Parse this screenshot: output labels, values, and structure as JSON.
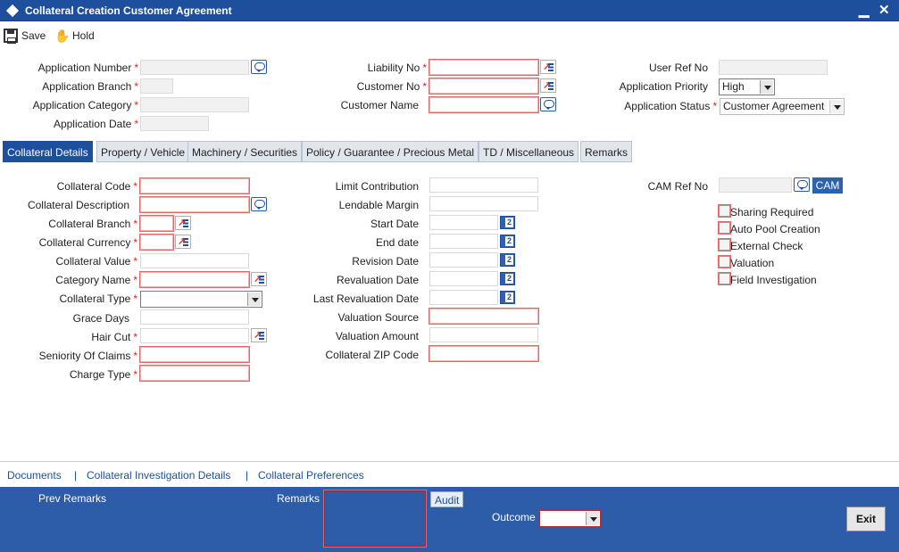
{
  "window": {
    "title": "Collateral Creation Customer Agreement"
  },
  "toolbar": {
    "save": "Save",
    "hold": "Hold"
  },
  "header": {
    "application_number": "Application Number",
    "application_branch": "Application Branch",
    "application_category": "Application Category",
    "application_date": "Application Date",
    "liability_no": "Liability No",
    "customer_no": "Customer No",
    "customer_name": "Customer Name",
    "user_ref_no": "User Ref No",
    "application_priority": "Application Priority",
    "application_status": "Application Status",
    "priority_value": "High",
    "status_value": "Customer Agreement"
  },
  "tabs": [
    "Collateral Details",
    "Property / Vehicle",
    "Machinery / Securities",
    "Policy / Guarantee / Precious Metal",
    "TD / Miscellaneous",
    "Remarks"
  ],
  "collateral": {
    "code": "Collateral Code",
    "description": "Collateral Description",
    "branch": "Collateral Branch",
    "currency": "Collateral Currency",
    "value": "Collateral Value",
    "category_name": "Category Name",
    "type": "Collateral Type",
    "grace_days": "Grace Days",
    "hair_cut": "Hair Cut",
    "seniority": "Seniority Of Claims",
    "charge_type": "Charge Type",
    "limit_contribution": "Limit Contribution",
    "lendable_margin": "Lendable Margin",
    "start_date": "Start Date",
    "end_date": "End date",
    "revision_date": "Revision Date",
    "revaluation_date": "Revaluation Date",
    "last_revaluation_date": "Last Revaluation Date",
    "valuation_source": "Valuation Source",
    "valuation_amount": "Valuation Amount",
    "zip_code": "Collateral ZIP Code",
    "cam_ref_no": "CAM Ref No",
    "cam_button": "CAM"
  },
  "checkboxes": [
    "Sharing Required",
    "Auto Pool Creation",
    "External Check",
    "Valuation",
    "Field Investigation"
  ],
  "links": {
    "documents": "Documents",
    "separator": "|",
    "investigation": "Collateral Investigation Details",
    "preferences": "Collateral Preferences"
  },
  "footer": {
    "prev_remarks": "Prev Remarks",
    "remarks": "Remarks",
    "audit": "Audit",
    "outcome": "Outcome",
    "exit": "Exit"
  },
  "colors": {
    "primary": "#1d4f9c",
    "footer": "#2d5ca8",
    "mandatory": "#e06a6a"
  }
}
